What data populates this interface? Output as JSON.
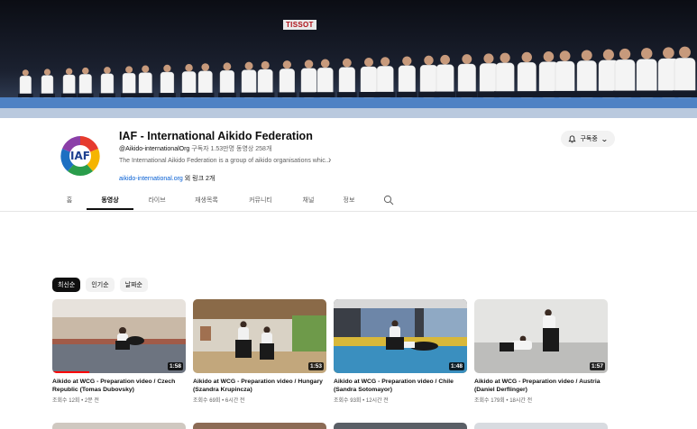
{
  "banner": {
    "sign_text": "TISSOT"
  },
  "channel": {
    "logo_text": "IAF",
    "title": "IAF - International Aikido Federation",
    "handle": "@Aikido-internationalOrg",
    "subscribers": "구독자 1.53만명",
    "video_count": "동영상 258개",
    "description": "The International Aikido Federation is a group of aikido organisations whic...",
    "link_url": "aikido-international.org",
    "link_more": "외 링크 2개"
  },
  "subscribe": {
    "label": "구독중",
    "icon": "bell-icon"
  },
  "tabs": [
    {
      "label": "홈",
      "active": false
    },
    {
      "label": "동영상",
      "active": true
    },
    {
      "label": "라이브",
      "active": false
    },
    {
      "label": "재생목록",
      "active": false
    },
    {
      "label": "커뮤니티",
      "active": false
    },
    {
      "label": "채널",
      "active": false
    },
    {
      "label": "정보",
      "active": false
    }
  ],
  "chips": [
    {
      "label": "최신순",
      "active": true
    },
    {
      "label": "인기순",
      "active": false
    },
    {
      "label": "날짜순",
      "active": false
    }
  ],
  "videos": [
    {
      "title": "Aikido at WCG - Preparation video / Czech Republic (Tomas Dubovsky)",
      "duration": "1:58",
      "meta": "조회수 12회 • 2분 전",
      "watched_fraction": 0.28
    },
    {
      "title": "Aikido at WCG - Preparation video / Hungary (Szandra Krupincza)",
      "duration": "1:53",
      "meta": "조회수 69회 • 6시간 전",
      "watched_fraction": 0
    },
    {
      "title": "Aikido at WCG - Preparation video / Chile (Sandra Sotomayor)",
      "duration": "1:48",
      "meta": "조회수 93회 • 12시간 전",
      "watched_fraction": 0
    },
    {
      "title": "Aikido at WCG - Preparation video / Austria (Daniel Derflinger)",
      "duration": "1:57",
      "meta": "조회수 179회 • 18시간 전",
      "watched_fraction": 0
    }
  ],
  "colors": {
    "accent": "#065fd4",
    "progress": "#ff0000",
    "text": "#0f0f0f",
    "secondary": "#606060"
  }
}
